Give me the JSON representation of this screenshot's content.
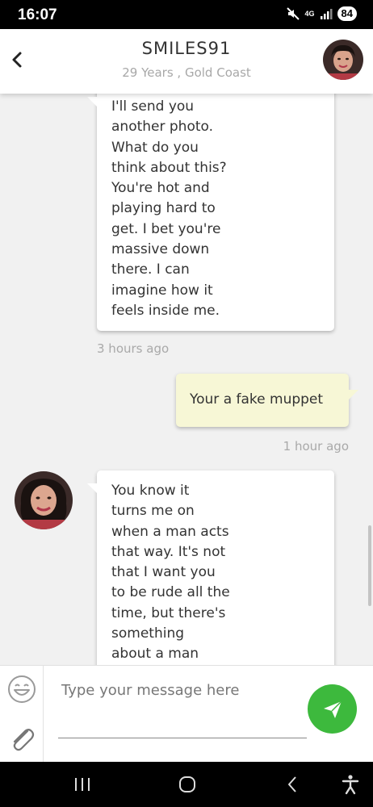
{
  "status_bar": {
    "time": "16:07",
    "network": "4G",
    "battery": "84"
  },
  "header": {
    "name": "SMILES91",
    "subtitle": "29 Years , Gold Coast"
  },
  "messages": [
    {
      "direction": "incoming",
      "text": "I'll send you\nanother photo.\nWhat do you\nthink about this?\nYou're hot and\nplaying hard to\nget. I bet you're\nmassive down\nthere. I can\nimagine how it\nfeels inside me.",
      "time": "3 hours ago"
    },
    {
      "direction": "outgoing",
      "text": "Your a fake muppet",
      "time": "1 hour ago"
    },
    {
      "direction": "incoming",
      "text": "You know it\nturns me on\nwhen a man acts\nthat way. It's not\nthat I want you\nto be rude all the\ntime, but there's\nsomething\nabout a man"
    }
  ],
  "composer": {
    "placeholder": "Type your message here",
    "value": ""
  },
  "icons": {
    "back": "chevron-left-icon",
    "emoji": "smiley-icon",
    "attach": "paperclip-icon",
    "send": "paper-plane-icon"
  },
  "colors": {
    "send_button": "#3db93d",
    "outgoing_bubble": "#f7f7d6",
    "chat_background": "#f1f1f1"
  }
}
